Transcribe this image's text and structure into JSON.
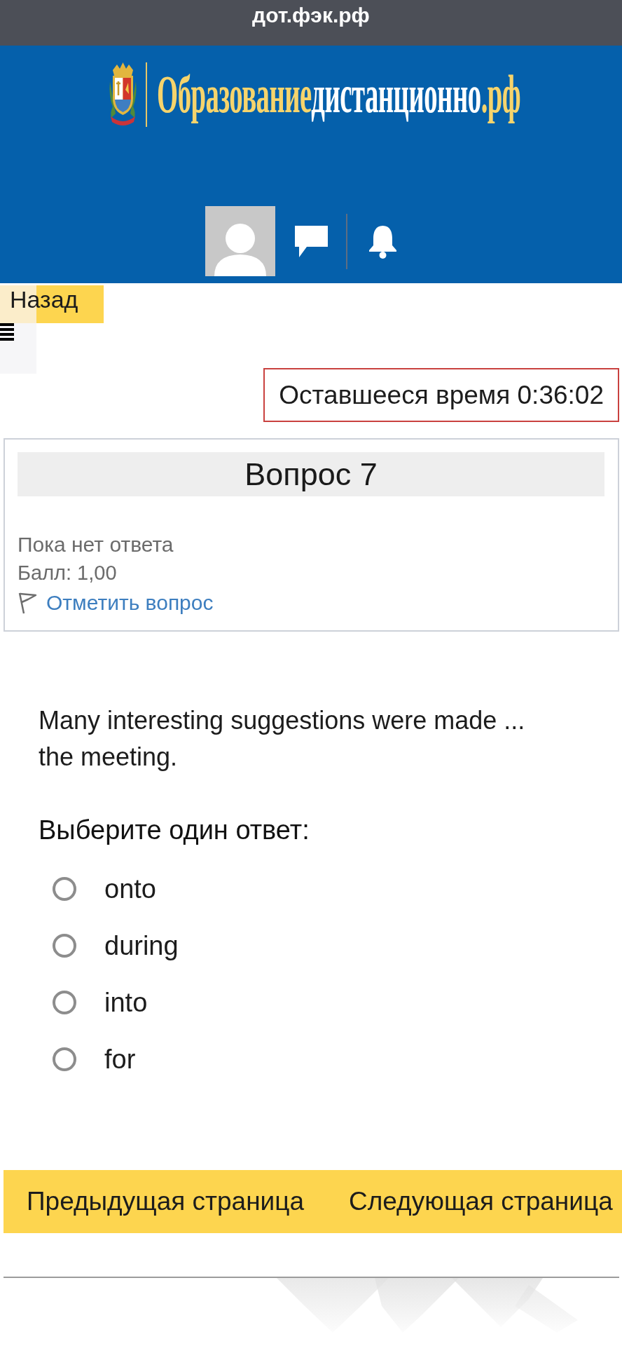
{
  "browser": {
    "address": "дот.фэк.рф"
  },
  "header": {
    "logo": [
      {
        "text": "Образование",
        "color": "#f6d46c"
      },
      {
        "text": "дистанционно",
        "color": "#ffffff"
      },
      {
        "text": ".рф",
        "color": "#f6d46c"
      }
    ]
  },
  "navigation": {
    "back": "Назад"
  },
  "timer": {
    "label": "Оставшееся время 0:36:02"
  },
  "question_info": {
    "title": "Вопрос 7",
    "status": "Пока нет ответа",
    "grade": "Балл: 1,00",
    "flag_link": "Отметить вопрос"
  },
  "question": {
    "text": "Many interesting suggestions were made ... the meeting.",
    "prompt": "Выберите один ответ:",
    "options": [
      {
        "label": "onto",
        "selected": false
      },
      {
        "label": "during",
        "selected": false
      },
      {
        "label": "into",
        "selected": false
      },
      {
        "label": "for",
        "selected": false
      }
    ]
  },
  "page_nav": [
    "Предыдущая страница",
    "Следующая страница"
  ]
}
